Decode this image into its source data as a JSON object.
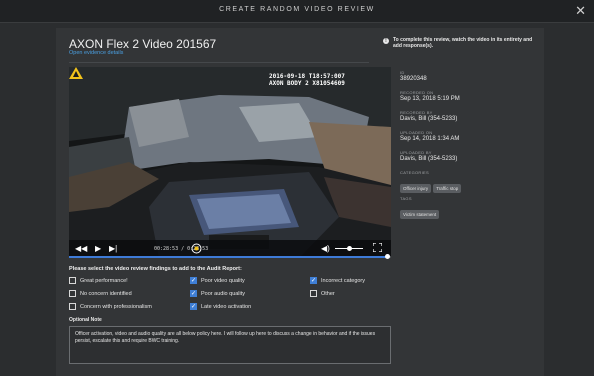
{
  "modal": {
    "title": "CREATE RANDOM VIDEO REVIEW",
    "close_symbol": "✕"
  },
  "header": {
    "video_title": "AXON Flex 2 Video 201567",
    "evidence_link": "Open evidence details",
    "notice": "To complete this review, watch the video in its entirety and add response(s)."
  },
  "video": {
    "overlay_line1": "2016-09-18 T18:57:007",
    "overlay_line2": "AXON BODY 2 X81054609",
    "time_display": "00:28:53 / 0:28:53",
    "progress_fraction": 0.99
  },
  "metadata": {
    "id_label": "ID",
    "id_value": "38920348",
    "recorded_label": "RECORDED ON",
    "recorded_value": "Sep 13, 2018 5:19 PM",
    "recorded_by_label": "RECORDED BY",
    "recorded_by_value": "Davis, Bill (354-5233)",
    "uploaded_label": "UPLOADED ON",
    "uploaded_value": "Sep 14, 2018 1:34 AM",
    "uploaded_by_label": "UPLOADED BY",
    "uploaded_by_value": "Davis, Bill (354-5233)",
    "categories_label": "CATEGORIES",
    "categories": [
      "Officer injury",
      "Traffic stop"
    ],
    "tags_label": "TAGS",
    "tags": [
      "Victim statement"
    ]
  },
  "findings": {
    "title": "Please select the video review findings to add to the Audit Report:",
    "options": [
      {
        "label": "Great performance!",
        "checked": false
      },
      {
        "label": "Poor video quality",
        "checked": true
      },
      {
        "label": "Incorrect category",
        "checked": true
      },
      {
        "label": "No concern identified",
        "checked": false
      },
      {
        "label": "Poor audio quality",
        "checked": true
      },
      {
        "label": "Other",
        "checked": false
      },
      {
        "label": "Concern with professionalism",
        "checked": false
      },
      {
        "label": "Late video activation",
        "checked": true
      }
    ]
  },
  "note": {
    "label": "Optional Note",
    "text": "Officer activation, video and audio quality are all below policy here. I will follow up here to discuss a change in behavior and if the issues persist, escalate this and require BWC training."
  },
  "colors": {
    "accent": "#3f7fd6",
    "link": "#4a9fe0",
    "warning": "#f2c21b"
  }
}
